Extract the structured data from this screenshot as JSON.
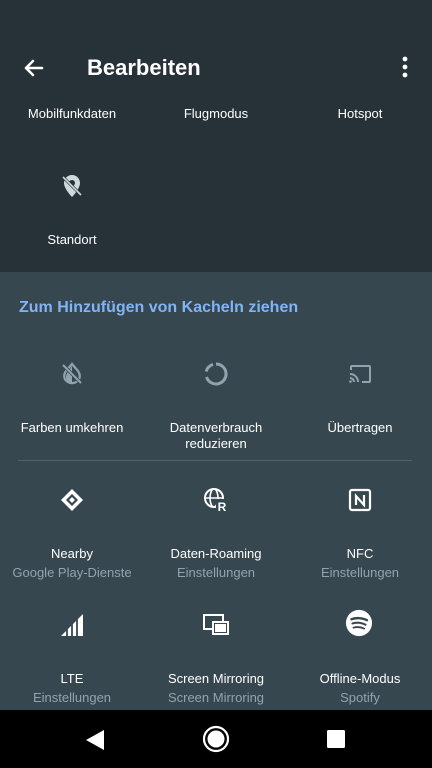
{
  "header": {
    "title": "Bearbeiten",
    "back_icon": "arrow-left-icon",
    "menu_icon": "more-vert-icon"
  },
  "active_tiles": [
    {
      "label": "Mobilfunkdaten"
    },
    {
      "label": "Flugmodus"
    },
    {
      "label": "Hotspot"
    },
    {
      "label": "Standort",
      "icon": "location-off-icon"
    }
  ],
  "available": {
    "header": "Zum Hinzufügen von Kacheln ziehen",
    "tiles": [
      {
        "label": "Farben umkehren",
        "sub": "",
        "icon": "invert-colors-off-icon"
      },
      {
        "label": "Datenverbrauch",
        "label2": "reduzieren",
        "icon": "data-saver-icon"
      },
      {
        "label": "Übertragen",
        "sub": "",
        "icon": "cast-icon"
      },
      {
        "label": "Nearby",
        "sub": "Google Play-Dienste",
        "icon": "nearby-icon"
      },
      {
        "label": "Daten-Roaming",
        "sub": "Einstellungen",
        "icon": "roaming-globe-icon"
      },
      {
        "label": "NFC",
        "sub": "Einstellungen",
        "icon": "nfc-icon"
      },
      {
        "label": "LTE",
        "sub": "Einstellungen",
        "icon": "signal-icon"
      },
      {
        "label": "Screen Mirroring",
        "sub": "Screen Mirroring",
        "icon": "screen-mirroring-icon"
      },
      {
        "label": "Offline-Modus",
        "sub": "Spotify",
        "icon": "spotify-icon"
      }
    ]
  },
  "colors": {
    "header_bg": "#263238",
    "available_bg": "#37474f",
    "accent": "#80b4f5",
    "subtext": "#90a4ae"
  },
  "navbar": {
    "back": "nav-back-icon",
    "home": "nav-home-icon",
    "recents": "nav-recents-icon"
  }
}
